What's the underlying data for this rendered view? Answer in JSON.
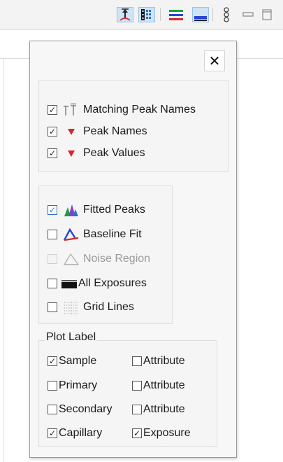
{
  "toolbar": {
    "icons": [
      "peak-marker-icon",
      "grid-table-icon",
      "colored-lines-icon",
      "underline-icon",
      "chain-icon",
      "minimize-icon",
      "maximize-icon"
    ],
    "colors": {
      "active_bg": "#cde4f7",
      "red": "#d7262b",
      "green": "#1f9d3a",
      "blue": "#2445d6"
    }
  },
  "popup": {
    "close_glyph": "✕",
    "group_peaks": {
      "items": [
        {
          "label": "Matching Peak Names",
          "checked": true,
          "icon": "matching-peak-names-icon"
        },
        {
          "label": "Peak Names",
          "checked": true,
          "icon": "red-triangle-icon"
        },
        {
          "label": "Peak Values",
          "checked": true,
          "icon": "red-triangle-icon"
        }
      ]
    },
    "group_layers": {
      "items": [
        {
          "label": "Fitted Peaks",
          "checked": true,
          "icon": "fitted-peaks-icon"
        },
        {
          "label": "Baseline Fit",
          "checked": false,
          "icon": "baseline-fit-icon"
        },
        {
          "label": "Noise Region",
          "checked": false,
          "disabled": true,
          "icon": "noise-region-icon"
        },
        {
          "label": "All Exposures",
          "checked": false,
          "icon": "all-exposures-icon"
        },
        {
          "label": "Grid Lines",
          "checked": false,
          "icon": "grid-lines-icon"
        }
      ]
    },
    "plot_label": {
      "title": "Plot Label",
      "rows": [
        {
          "left": {
            "label": "Sample",
            "checked": true
          },
          "right": {
            "label": "Attribute",
            "checked": false
          }
        },
        {
          "left": {
            "label": "Primary",
            "checked": false
          },
          "right": {
            "label": "Attribute",
            "checked": false
          }
        },
        {
          "left": {
            "label": "Secondary",
            "checked": false
          },
          "right": {
            "label": "Attribute",
            "checked": false
          }
        },
        {
          "left": {
            "label": "Capillary",
            "checked": true
          },
          "right": {
            "label": "Exposure",
            "checked": true
          }
        }
      ]
    },
    "check_glyph": "✓"
  }
}
